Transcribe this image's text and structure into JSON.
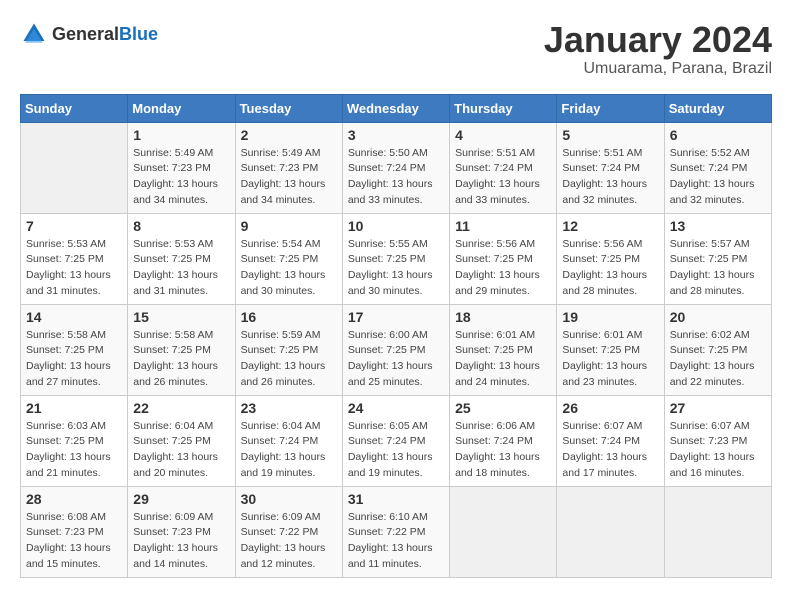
{
  "logo": {
    "general": "General",
    "blue": "Blue"
  },
  "title": "January 2024",
  "location": "Umuarama, Parana, Brazil",
  "weekdays": [
    "Sunday",
    "Monday",
    "Tuesday",
    "Wednesday",
    "Thursday",
    "Friday",
    "Saturday"
  ],
  "weeks": [
    [
      {
        "day": "",
        "sunrise": "",
        "sunset": "",
        "daylight": ""
      },
      {
        "day": "1",
        "sunrise": "Sunrise: 5:49 AM",
        "sunset": "Sunset: 7:23 PM",
        "daylight": "Daylight: 13 hours and 34 minutes."
      },
      {
        "day": "2",
        "sunrise": "Sunrise: 5:49 AM",
        "sunset": "Sunset: 7:23 PM",
        "daylight": "Daylight: 13 hours and 34 minutes."
      },
      {
        "day": "3",
        "sunrise": "Sunrise: 5:50 AM",
        "sunset": "Sunset: 7:24 PM",
        "daylight": "Daylight: 13 hours and 33 minutes."
      },
      {
        "day": "4",
        "sunrise": "Sunrise: 5:51 AM",
        "sunset": "Sunset: 7:24 PM",
        "daylight": "Daylight: 13 hours and 33 minutes."
      },
      {
        "day": "5",
        "sunrise": "Sunrise: 5:51 AM",
        "sunset": "Sunset: 7:24 PM",
        "daylight": "Daylight: 13 hours and 32 minutes."
      },
      {
        "day": "6",
        "sunrise": "Sunrise: 5:52 AM",
        "sunset": "Sunset: 7:24 PM",
        "daylight": "Daylight: 13 hours and 32 minutes."
      }
    ],
    [
      {
        "day": "7",
        "sunrise": "Sunrise: 5:53 AM",
        "sunset": "Sunset: 7:25 PM",
        "daylight": "Daylight: 13 hours and 31 minutes."
      },
      {
        "day": "8",
        "sunrise": "Sunrise: 5:53 AM",
        "sunset": "Sunset: 7:25 PM",
        "daylight": "Daylight: 13 hours and 31 minutes."
      },
      {
        "day": "9",
        "sunrise": "Sunrise: 5:54 AM",
        "sunset": "Sunset: 7:25 PM",
        "daylight": "Daylight: 13 hours and 30 minutes."
      },
      {
        "day": "10",
        "sunrise": "Sunrise: 5:55 AM",
        "sunset": "Sunset: 7:25 PM",
        "daylight": "Daylight: 13 hours and 30 minutes."
      },
      {
        "day": "11",
        "sunrise": "Sunrise: 5:56 AM",
        "sunset": "Sunset: 7:25 PM",
        "daylight": "Daylight: 13 hours and 29 minutes."
      },
      {
        "day": "12",
        "sunrise": "Sunrise: 5:56 AM",
        "sunset": "Sunset: 7:25 PM",
        "daylight": "Daylight: 13 hours and 28 minutes."
      },
      {
        "day": "13",
        "sunrise": "Sunrise: 5:57 AM",
        "sunset": "Sunset: 7:25 PM",
        "daylight": "Daylight: 13 hours and 28 minutes."
      }
    ],
    [
      {
        "day": "14",
        "sunrise": "Sunrise: 5:58 AM",
        "sunset": "Sunset: 7:25 PM",
        "daylight": "Daylight: 13 hours and 27 minutes."
      },
      {
        "day": "15",
        "sunrise": "Sunrise: 5:58 AM",
        "sunset": "Sunset: 7:25 PM",
        "daylight": "Daylight: 13 hours and 26 minutes."
      },
      {
        "day": "16",
        "sunrise": "Sunrise: 5:59 AM",
        "sunset": "Sunset: 7:25 PM",
        "daylight": "Daylight: 13 hours and 26 minutes."
      },
      {
        "day": "17",
        "sunrise": "Sunrise: 6:00 AM",
        "sunset": "Sunset: 7:25 PM",
        "daylight": "Daylight: 13 hours and 25 minutes."
      },
      {
        "day": "18",
        "sunrise": "Sunrise: 6:01 AM",
        "sunset": "Sunset: 7:25 PM",
        "daylight": "Daylight: 13 hours and 24 minutes."
      },
      {
        "day": "19",
        "sunrise": "Sunrise: 6:01 AM",
        "sunset": "Sunset: 7:25 PM",
        "daylight": "Daylight: 13 hours and 23 minutes."
      },
      {
        "day": "20",
        "sunrise": "Sunrise: 6:02 AM",
        "sunset": "Sunset: 7:25 PM",
        "daylight": "Daylight: 13 hours and 22 minutes."
      }
    ],
    [
      {
        "day": "21",
        "sunrise": "Sunrise: 6:03 AM",
        "sunset": "Sunset: 7:25 PM",
        "daylight": "Daylight: 13 hours and 21 minutes."
      },
      {
        "day": "22",
        "sunrise": "Sunrise: 6:04 AM",
        "sunset": "Sunset: 7:25 PM",
        "daylight": "Daylight: 13 hours and 20 minutes."
      },
      {
        "day": "23",
        "sunrise": "Sunrise: 6:04 AM",
        "sunset": "Sunset: 7:24 PM",
        "daylight": "Daylight: 13 hours and 19 minutes."
      },
      {
        "day": "24",
        "sunrise": "Sunrise: 6:05 AM",
        "sunset": "Sunset: 7:24 PM",
        "daylight": "Daylight: 13 hours and 19 minutes."
      },
      {
        "day": "25",
        "sunrise": "Sunrise: 6:06 AM",
        "sunset": "Sunset: 7:24 PM",
        "daylight": "Daylight: 13 hours and 18 minutes."
      },
      {
        "day": "26",
        "sunrise": "Sunrise: 6:07 AM",
        "sunset": "Sunset: 7:24 PM",
        "daylight": "Daylight: 13 hours and 17 minutes."
      },
      {
        "day": "27",
        "sunrise": "Sunrise: 6:07 AM",
        "sunset": "Sunset: 7:23 PM",
        "daylight": "Daylight: 13 hours and 16 minutes."
      }
    ],
    [
      {
        "day": "28",
        "sunrise": "Sunrise: 6:08 AM",
        "sunset": "Sunset: 7:23 PM",
        "daylight": "Daylight: 13 hours and 15 minutes."
      },
      {
        "day": "29",
        "sunrise": "Sunrise: 6:09 AM",
        "sunset": "Sunset: 7:23 PM",
        "daylight": "Daylight: 13 hours and 14 minutes."
      },
      {
        "day": "30",
        "sunrise": "Sunrise: 6:09 AM",
        "sunset": "Sunset: 7:22 PM",
        "daylight": "Daylight: 13 hours and 12 minutes."
      },
      {
        "day": "31",
        "sunrise": "Sunrise: 6:10 AM",
        "sunset": "Sunset: 7:22 PM",
        "daylight": "Daylight: 13 hours and 11 minutes."
      },
      {
        "day": "",
        "sunrise": "",
        "sunset": "",
        "daylight": ""
      },
      {
        "day": "",
        "sunrise": "",
        "sunset": "",
        "daylight": ""
      },
      {
        "day": "",
        "sunrise": "",
        "sunset": "",
        "daylight": ""
      }
    ]
  ]
}
